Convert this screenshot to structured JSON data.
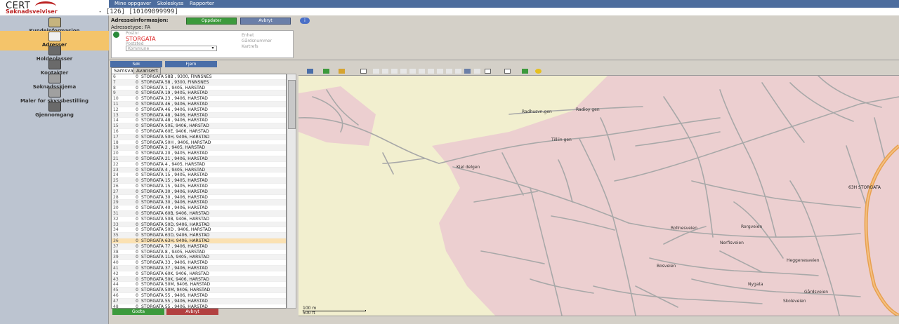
{
  "header": {
    "logo_text": "CERT",
    "module_title": "Søknadsveiviser",
    "case_id": "- [126] [10109899999]",
    "nav": [
      "Mine oppgaver",
      "Skoleskyss",
      "Rapporter"
    ]
  },
  "sidebar": {
    "items": [
      {
        "label": "Kundeinformasjon",
        "icon": "person-card-icon",
        "active": false
      },
      {
        "label": "Adresser",
        "icon": "house-icon",
        "active": true
      },
      {
        "label": "Holdeplasser",
        "icon": "bus-stop-icon",
        "active": false
      },
      {
        "label": "Kontakter",
        "icon": "contacts-icon",
        "active": false
      },
      {
        "label": "Søknadsskjema",
        "icon": "form-icon",
        "active": false
      },
      {
        "label": "Maler for skyssbestilling",
        "icon": "template-icon",
        "active": false
      },
      {
        "label": "Gjennomgang",
        "icon": "review-icon",
        "active": false
      }
    ]
  },
  "address_panel": {
    "title": "Adresseinformasjon:",
    "update_label": "Oppdater",
    "cancel_label": "Avbryt",
    "info_label": "i",
    "address_type": "Adressetype: FA",
    "postal_code_label": "Postnr",
    "street_value": "STORGATA",
    "postal_place_label": "Poststed",
    "municipality_label": "Kommune",
    "unit_label": "Enhet",
    "property_number_label": "Gårdsnummer",
    "note_label": "Kartrefs"
  },
  "search": {
    "search_label": "Søk",
    "remove_label": "Fjern"
  },
  "tabs": [
    {
      "label": "Samsvar",
      "active": true
    },
    {
      "label": "Avansert",
      "active": false
    }
  ],
  "results": {
    "rows": [
      {
        "n": "6",
        "score": "0",
        "text": "STORGATA 58B , 9300, FINNSNES"
      },
      {
        "n": "7",
        "score": "0",
        "text": "STORGATA 58 , 9300, FINNSNES"
      },
      {
        "n": "8",
        "score": "0",
        "text": "STORGATA 1 , 9405, HARSTAD"
      },
      {
        "n": "9",
        "score": "0",
        "text": "STORGATA 19 , 9405, HARSTAD"
      },
      {
        "n": "10",
        "score": "0",
        "text": "STORGATA 23 , 9406, HARSTAD"
      },
      {
        "n": "11",
        "score": "0",
        "text": "STORGATA 46 , 9406, HARSTAD"
      },
      {
        "n": "12",
        "score": "0",
        "text": "STORGATA 46 , 9406, HARSTAD"
      },
      {
        "n": "13",
        "score": "0",
        "text": "STORGATA 48 , 9406, HARSTAD"
      },
      {
        "n": "14",
        "score": "0",
        "text": "STORGATA 48 , 9406, HARSTAD"
      },
      {
        "n": "15",
        "score": "0",
        "text": "STORGATA 50E, 9406, HARSTAD"
      },
      {
        "n": "16",
        "score": "0",
        "text": "STORGATA 60E, 9406, HARSTAD"
      },
      {
        "n": "17",
        "score": "0",
        "text": "STORGATA 50H, 9406, HARSTAD"
      },
      {
        "n": "18",
        "score": "0",
        "text": "STORGATA 50H , 9406, HARSTAD"
      },
      {
        "n": "19",
        "score": "0",
        "text": "STORGATA 2 , 9405, HARSTAD"
      },
      {
        "n": "20",
        "score": "0",
        "text": "STORGATA 20 , 9405, HARSTAD"
      },
      {
        "n": "21",
        "score": "0",
        "text": "STORGATA 21 , 9406, HARSTAD"
      },
      {
        "n": "22",
        "score": "0",
        "text": "STORGATA 4 , 9405, HARSTAD"
      },
      {
        "n": "23",
        "score": "0",
        "text": "STORGATA 4 , 9405, HARSTAD"
      },
      {
        "n": "24",
        "score": "0",
        "text": "STORGATA 15 , 9405, HARSTAD"
      },
      {
        "n": "25",
        "score": "0",
        "text": "STORGATA 15 , 9405, HARSTAD"
      },
      {
        "n": "26",
        "score": "0",
        "text": "STORGATA 15 , 9405, HARSTAD"
      },
      {
        "n": "27",
        "score": "0",
        "text": "STORGATA 30 , 9406, HARSTAD"
      },
      {
        "n": "28",
        "score": "0",
        "text": "STORGATA 30 , 9406, HARSTAD"
      },
      {
        "n": "29",
        "score": "0",
        "text": "STORGATA 30 , 9406, HARSTAD"
      },
      {
        "n": "30",
        "score": "0",
        "text": "STORGATA 40 , 9406, HARSTAD"
      },
      {
        "n": "31",
        "score": "0",
        "text": "STORGATA 60B, 9406, HARSTAD"
      },
      {
        "n": "32",
        "score": "0",
        "text": "STORGATA 50B, 9406, HARSTAD"
      },
      {
        "n": "33",
        "score": "0",
        "text": "STORGATA 50D, 9406, HARSTAD"
      },
      {
        "n": "34",
        "score": "0",
        "text": "STORGATA 50D , 9406, HARSTAD"
      },
      {
        "n": "35",
        "score": "0",
        "text": "STORGATA 63D, 9406, HARSTAD"
      },
      {
        "n": "36",
        "score": "0",
        "text": "STORGATA 63H, 9406, HARSTAD"
      },
      {
        "n": "37",
        "score": "0",
        "text": "STORGATA 77 , 9406, HARSTAD"
      },
      {
        "n": "38",
        "score": "0",
        "text": "STORGATA 8 , 9405, HARSTAD"
      },
      {
        "n": "39",
        "score": "0",
        "text": "STORGATA 11A, 9405, HARSTAD"
      },
      {
        "n": "40",
        "score": "0",
        "text": "STORGATA 33 , 9406, HARSTAD"
      },
      {
        "n": "41",
        "score": "0",
        "text": "STORGATA 37 , 9406, HARSTAD"
      },
      {
        "n": "42",
        "score": "0",
        "text": "STORGATA 60K, 9406, HARSTAD"
      },
      {
        "n": "43",
        "score": "0",
        "text": "STORGATA 50K, 9406, HARSTAD"
      },
      {
        "n": "44",
        "score": "0",
        "text": "STORGATA 50M, 9406, HARSTAD"
      },
      {
        "n": "45",
        "score": "0",
        "text": "STORGATA 50M, 9406, HARSTAD"
      },
      {
        "n": "46",
        "score": "0",
        "text": "STORGATA 55 , 9406, HARSTAD"
      },
      {
        "n": "47",
        "score": "0",
        "text": "STORGATA 55 , 9406, HARSTAD"
      },
      {
        "n": "48",
        "score": "0",
        "text": "STORGATA 55 , 9406, HARSTAD"
      }
    ],
    "selected_n": "36"
  },
  "bottom": {
    "ok_label": "Godta",
    "cancel_label": "Avbryt"
  },
  "map": {
    "labels": [
      "Radhusvn.gen",
      "Radioy gen",
      "Tilliin gen",
      "Kiel delgen",
      "63H STORGATA",
      "Rollnesveien",
      "Rorgveien",
      "Nerfisveien",
      "Bosveien",
      "Heggenesveien",
      "Gårdsveien",
      "Skoleveien",
      "Nygata"
    ],
    "scale_m": "100 m",
    "scale_ft": "500 ft",
    "colors": {
      "land": "#f2efcf",
      "urban": "#eccfd0",
      "road": "#a8a8a8",
      "major_road": "#e8a050"
    }
  }
}
